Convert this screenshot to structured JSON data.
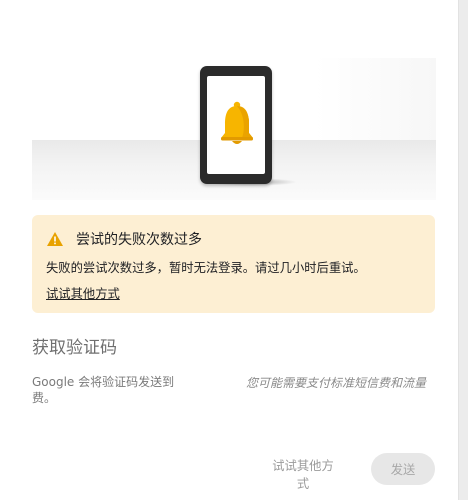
{
  "colors": {
    "banner_bg": "#fdefd3",
    "warning_icon": "#e8a200",
    "bell": "#f7b500"
  },
  "illustration": {
    "icon": "bell-icon",
    "device": "phone-illustration"
  },
  "banner": {
    "icon": "warning-icon",
    "title": "尝试的失败次数过多",
    "message": "失败的尝试次数过多，暂时无法登录。请过几小时后重试。",
    "link_label": "试试其他方式"
  },
  "section": {
    "title": "获取验证码",
    "description_left": "Google 会将验证码发送到费。",
    "description_right": "您可能需要支付标准短信费和流量"
  },
  "actions": {
    "other_label": "试试其他方式",
    "send_label": "发送"
  }
}
